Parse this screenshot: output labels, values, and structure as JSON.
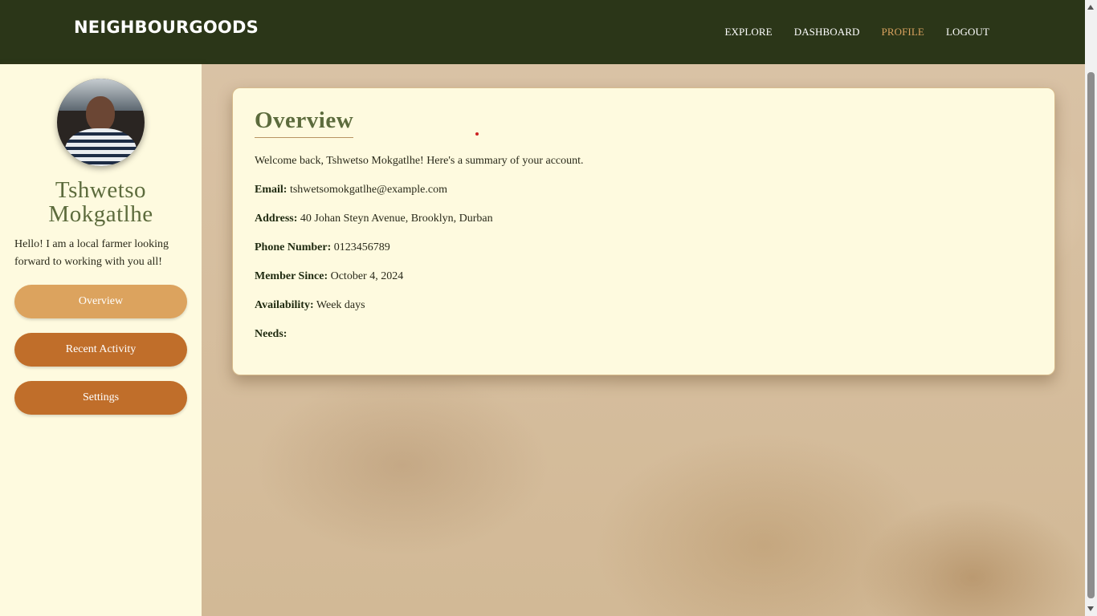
{
  "header": {
    "brand": "NEIGHBOURGOODS",
    "nav": [
      {
        "label": "EXPLORE"
      },
      {
        "label": "DASHBOARD"
      },
      {
        "label": "PROFILE"
      },
      {
        "label": "LOGOUT"
      }
    ],
    "active_nav": "PROFILE"
  },
  "sidebar": {
    "name": "Tshwetso Mokgatlhe",
    "bio": "Hello! I am a local farmer looking forward to working with you all!",
    "buttons": [
      {
        "label": "Overview"
      },
      {
        "label": "Recent Activity"
      },
      {
        "label": "Settings"
      }
    ]
  },
  "overview": {
    "title": "Overview",
    "welcome": "Welcome back, Tshwetso Mokgatlhe! Here's a summary of your account.",
    "fields": [
      {
        "label": "Email:",
        "value": "tshwetsomokgatlhe@example.com"
      },
      {
        "label": "Address:",
        "value": "40 Johan Steyn Avenue, Brooklyn, Durban"
      },
      {
        "label": "Phone Number:",
        "value": "0123456789"
      },
      {
        "label": "Member Since:",
        "value": "October 4, 2024"
      },
      {
        "label": "Availability:",
        "value": "Week days"
      },
      {
        "label": "Needs:",
        "value": ""
      }
    ]
  },
  "colors": {
    "header_bg": "#2b3618",
    "active_nav": "#d9a25f",
    "sidebar_bg": "#fefadf",
    "button_primary": "#dca35e",
    "button_secondary": "#c06e2a",
    "title_green": "#5c6b3c"
  }
}
